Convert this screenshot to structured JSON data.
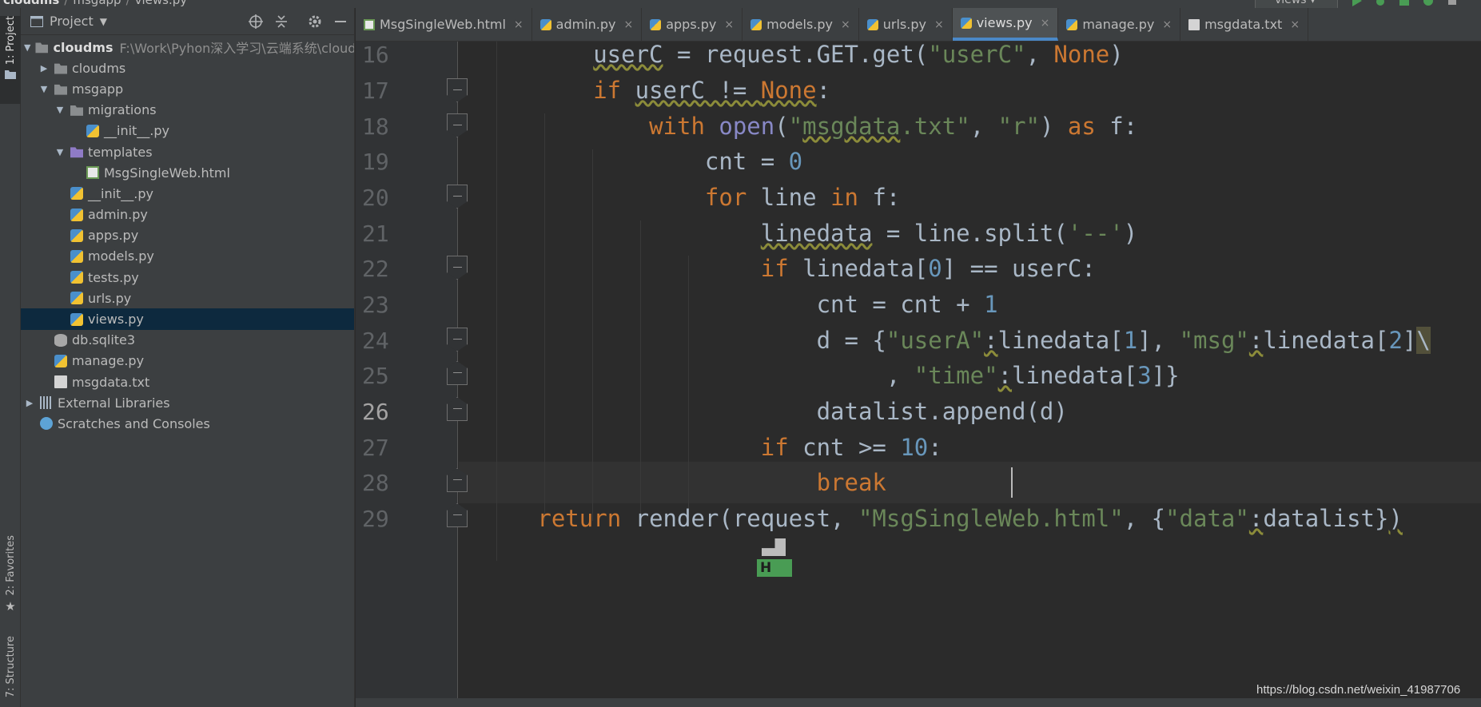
{
  "breadcrumbs": [
    "cloudms",
    "msgapp",
    "views.py"
  ],
  "run_config": "views",
  "left_strip": {
    "project_tab": "1: Project",
    "favorites_tab": "2: Favorites",
    "structure_tab": "7: Structure"
  },
  "project_panel": {
    "title": "Project",
    "tree": [
      {
        "label": "cloudms",
        "path": "F:\\Work\\Pyhon深入学习\\云端系统\\cloudms"
      },
      {
        "label": "cloudms"
      },
      {
        "label": "msgapp"
      },
      {
        "label": "migrations"
      },
      {
        "label": "__init__.py"
      },
      {
        "label": "templates"
      },
      {
        "label": "MsgSingleWeb.html"
      },
      {
        "label": "__init__.py"
      },
      {
        "label": "admin.py"
      },
      {
        "label": "apps.py"
      },
      {
        "label": "models.py"
      },
      {
        "label": "tests.py"
      },
      {
        "label": "urls.py"
      },
      {
        "label": "views.py"
      },
      {
        "label": "db.sqlite3"
      },
      {
        "label": "manage.py"
      },
      {
        "label": "msgdata.txt"
      },
      {
        "label": "External Libraries"
      },
      {
        "label": "Scratches and Consoles"
      }
    ]
  },
  "tabs": [
    {
      "label": "MsgSingleWeb.html"
    },
    {
      "label": "admin.py"
    },
    {
      "label": "apps.py"
    },
    {
      "label": "models.py"
    },
    {
      "label": "urls.py"
    },
    {
      "label": "views.py"
    },
    {
      "label": "manage.py"
    },
    {
      "label": "msgdata.txt"
    }
  ],
  "active_tab": "views.py",
  "editor": {
    "line_numbers": [
      "16",
      "17",
      "18",
      "19",
      "20",
      "21",
      "22",
      "23",
      "24",
      "25",
      "26",
      "27",
      "28",
      "29"
    ],
    "current_line": "26"
  },
  "badge_letter": "H",
  "watermark": "https://blog.csdn.net/weixin_41987706",
  "colors": {
    "keyword": "#cc7832",
    "string": "#6a8759",
    "number": "#6897bb",
    "builtin": "#8888c6",
    "text": "#a9b7c6",
    "selection": "#0d293e"
  }
}
